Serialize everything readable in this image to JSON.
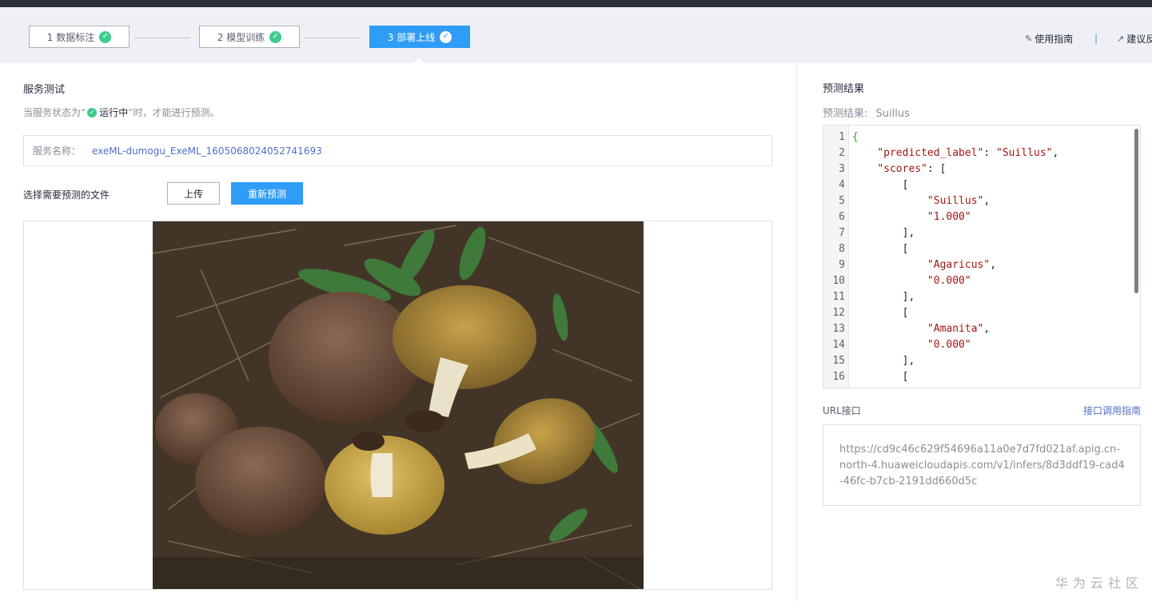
{
  "steps": [
    {
      "label": "1 数据标注",
      "done": true
    },
    {
      "label": "2 模型训练",
      "done": true
    },
    {
      "label": "3 部署上线",
      "done": true,
      "active": true
    }
  ],
  "toplinks": {
    "guide": "使用指南",
    "feedback": "建议反馈"
  },
  "service_test": {
    "title": "服务测试",
    "hint_prefix": "当服务状态为“",
    "hint_status": "运行中",
    "hint_suffix": "”时，才能进行预测。",
    "service_name_label": "服务名称：",
    "service_name_value": "exeML-dumogu_ExeML_1605068024052741693",
    "file_label": "选择需要预测的文件",
    "upload_label": "上传",
    "repredict_label": "重新预测",
    "image_alt": "mushroom photo"
  },
  "prediction": {
    "title": "预测结果",
    "result_label": "预测结果:",
    "result_value": "Suillus",
    "json_lines": [
      "{",
      "    \"predicted_label\": \"Suillus\",",
      "    \"scores\": [",
      "        [",
      "            \"Suillus\",",
      "            \"1.000\"",
      "        ],",
      "        [",
      "            \"Agaricus\",",
      "            \"0.000\"",
      "        ],",
      "        [",
      "            \"Amanita\",",
      "            \"0.000\"",
      "        ],",
      "        ["
    ]
  },
  "url": {
    "label": "URL接口",
    "guide_link": "接口调用指南",
    "value": "https://cd9c46c629f54696a11a0e7d7fd021af.apig.cn-north-4.huaweicloudapis.com/v1/infers/8d3ddf19-cad4-46fc-b7cb-2191dd660d5c"
  },
  "watermark": "华为云社区",
  "colors": {
    "accent": "#2f9cf5",
    "success": "#3dcc8e",
    "link": "#526ecc"
  }
}
